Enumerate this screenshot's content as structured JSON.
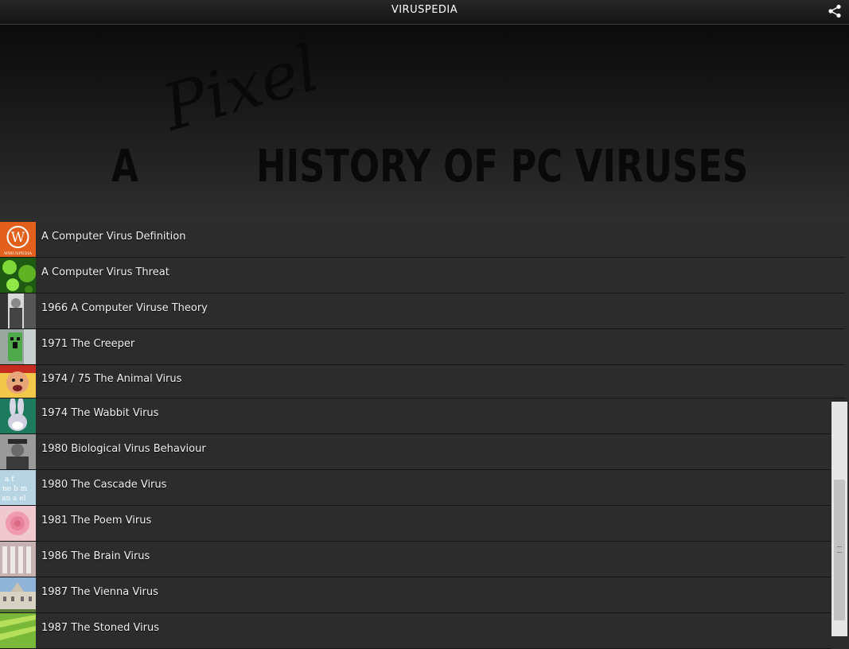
{
  "appbar": {
    "title": "VIRUSPEDIA",
    "share_icon": "share-icon"
  },
  "banner": {
    "word_a": "A",
    "word_pixel": "Pixel",
    "title": "HISTORY OF PC VIRUSES"
  },
  "list": {
    "items": [
      {
        "label": "A Computer Virus Definition",
        "thumb": "wikipedia-logo-icon"
      },
      {
        "label": "A Computer Virus Threat",
        "thumb": "green-virus-image"
      },
      {
        "label": "1966 A Computer Viruse Theory",
        "thumb": "scientist-photo"
      },
      {
        "label": "1971 The Creeper",
        "thumb": "creeper-image"
      },
      {
        "label": "1974 / 75 The Animal Virus",
        "thumb": "face-image"
      },
      {
        "label": "1974 The Wabbit Virus",
        "thumb": "rabbit-cartoon-image"
      },
      {
        "label": "1980 Biological Virus Behaviour",
        "thumb": "portrait-photo"
      },
      {
        "label": "1980 The Cascade Virus",
        "thumb": "falling-letters-image"
      },
      {
        "label": "1981 The Poem Virus",
        "thumb": "rose-image"
      },
      {
        "label": "1986 The Brain Virus",
        "thumb": "building-photo"
      },
      {
        "label": "1987 The Vienna Virus",
        "thumb": "vienna-palace-photo"
      },
      {
        "label": "1987 The Stoned Virus",
        "thumb": "green-leaf-image"
      }
    ]
  },
  "colors": {
    "background": "#2b2b2b",
    "appbar": "#1a1a1a",
    "text": "#f2f2f2",
    "wikipedia_orange": "#e2601b"
  }
}
